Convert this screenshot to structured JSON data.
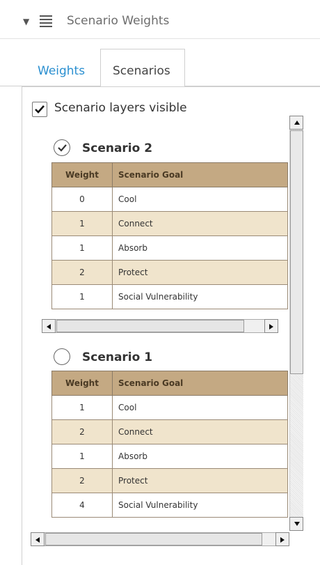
{
  "header": {
    "title": "Scenario Weights",
    "caret_icon": "caret-down-icon",
    "list_icon": "list-icon"
  },
  "tabs": [
    {
      "label": "Weights",
      "active": false
    },
    {
      "label": "Scenarios",
      "active": true
    }
  ],
  "visibility": {
    "label": "Scenario layers visible",
    "checked": true
  },
  "columns": {
    "weight": "Weight",
    "goal": "Scenario Goal"
  },
  "scenarios": [
    {
      "title": "Scenario 2",
      "selected": true,
      "rows": [
        {
          "weight": "0",
          "goal": "Cool"
        },
        {
          "weight": "1",
          "goal": "Connect"
        },
        {
          "weight": "1",
          "goal": "Absorb"
        },
        {
          "weight": "2",
          "goal": "Protect"
        },
        {
          "weight": "1",
          "goal": "Social Vulnerability"
        }
      ]
    },
    {
      "title": "Scenario 1",
      "selected": false,
      "rows": [
        {
          "weight": "1",
          "goal": "Cool"
        },
        {
          "weight": "2",
          "goal": "Connect"
        },
        {
          "weight": "1",
          "goal": "Absorb"
        },
        {
          "weight": "2",
          "goal": "Protect"
        },
        {
          "weight": "4",
          "goal": "Social Vulnerability"
        }
      ]
    }
  ],
  "colors": {
    "accent": "#2a8fd0",
    "header_row": "#c4a983",
    "alt_row": "#f0e4cc"
  }
}
